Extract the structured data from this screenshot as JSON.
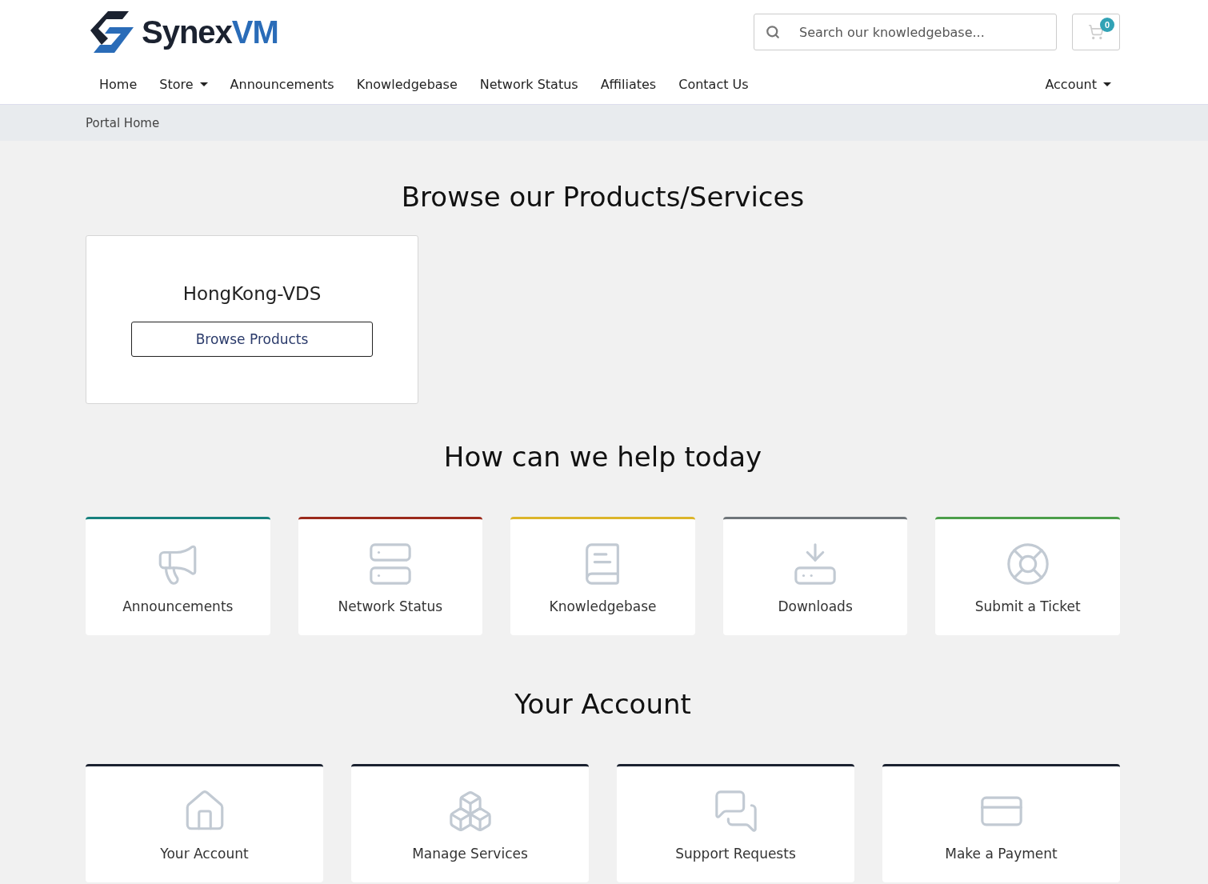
{
  "logo": {
    "name_part_1": "Synex",
    "name_part_2": "VM"
  },
  "search": {
    "placeholder": "Search our knowledgebase..."
  },
  "cart": {
    "count": "0"
  },
  "nav": [
    {
      "label": "Home",
      "dropdown": false
    },
    {
      "label": "Store",
      "dropdown": true
    },
    {
      "label": "Announcements",
      "dropdown": false
    },
    {
      "label": "Knowledgebase",
      "dropdown": false
    },
    {
      "label": "Network Status",
      "dropdown": false
    },
    {
      "label": "Affiliates",
      "dropdown": false
    },
    {
      "label": "Contact Us",
      "dropdown": false
    }
  ],
  "account_menu": {
    "label": "Account"
  },
  "breadcrumb": [
    "Portal Home"
  ],
  "products": {
    "heading": "Browse our Products/Services",
    "items": [
      {
        "name": "HongKong-VDS",
        "button": "Browse Products"
      }
    ]
  },
  "help": {
    "heading": "How can we help today",
    "cards": [
      {
        "label": "Announcements",
        "kind": "megaphone",
        "color": "#17817e"
      },
      {
        "label": "Network Status",
        "kind": "server",
        "color": "#9b2a1c"
      },
      {
        "label": "Knowledgebase",
        "kind": "book",
        "color": "#dcb52a"
      },
      {
        "label": "Downloads",
        "kind": "download",
        "color": "#6f757a"
      },
      {
        "label": "Submit a Ticket",
        "kind": "lifebuoy",
        "color": "#4c9e4a"
      }
    ]
  },
  "account": {
    "heading": "Your Account",
    "cards": [
      {
        "label": "Your Account",
        "kind": "house"
      },
      {
        "label": "Manage Services",
        "kind": "boxes"
      },
      {
        "label": "Support Requests",
        "kind": "chat"
      },
      {
        "label": "Make a Payment",
        "kind": "card"
      }
    ]
  }
}
